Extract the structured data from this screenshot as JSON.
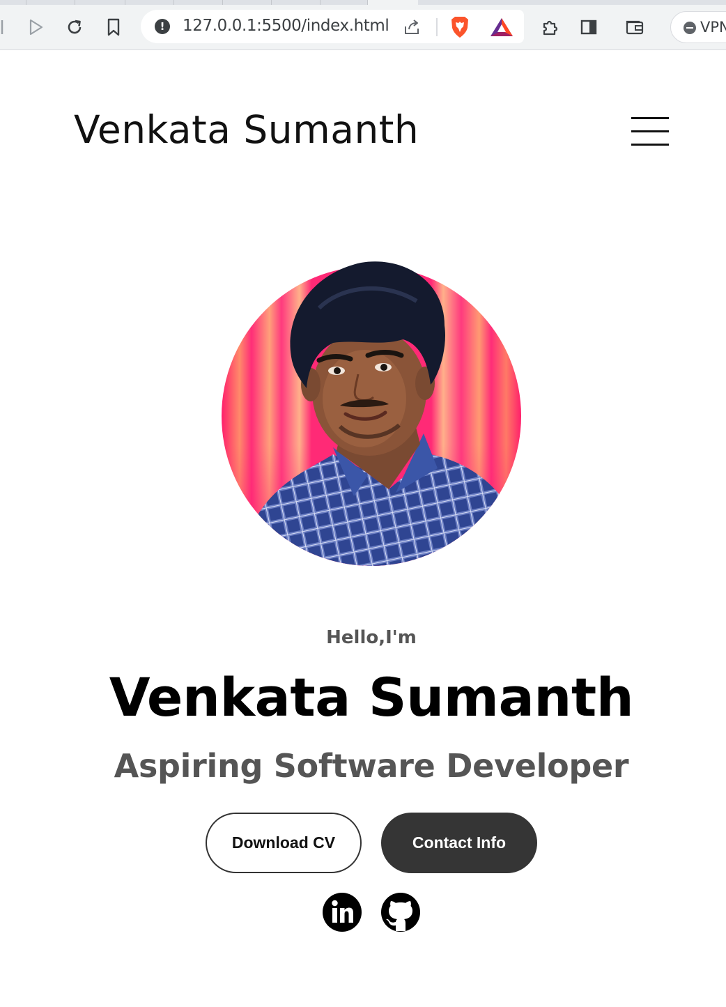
{
  "browser": {
    "url": "127.0.0.1:5500/index.html",
    "vpn_label": "VPN"
  },
  "header": {
    "logo_text": "Venkata Sumanth"
  },
  "hero": {
    "greeting": "Hello,I'm",
    "name": "Venkata Sumanth",
    "role": "Aspiring Software Developer",
    "buttons": {
      "download_cv": "Download CV",
      "contact_info": "Contact Info"
    },
    "social_icons": [
      "linkedin-icon",
      "github-icon"
    ]
  },
  "colors": {
    "text_primary": "#000000",
    "text_secondary": "#555555",
    "button_dark": "#353535",
    "photo_background_pink": "#ff2a7a",
    "photo_background_orange": "#ff9a6a",
    "shirt_blue": "#3a4f9e"
  }
}
